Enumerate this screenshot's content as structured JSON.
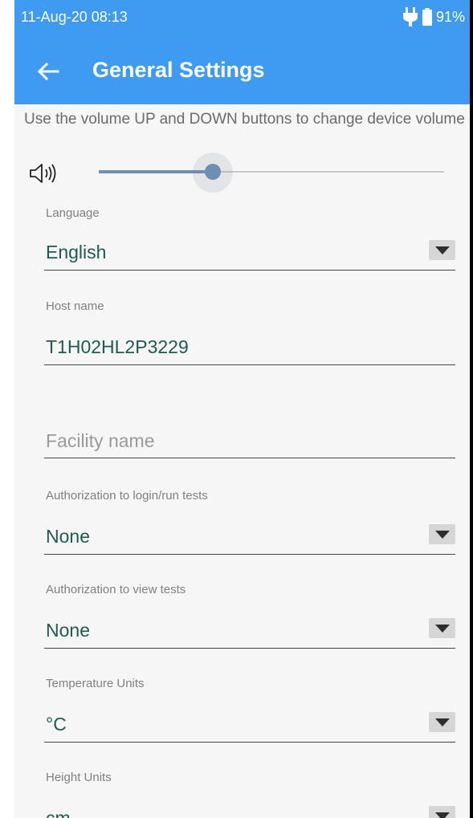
{
  "status_bar": {
    "datetime": "11-Aug-20 08:13",
    "battery": "91%",
    "icons": [
      "charging-plug-icon",
      "battery-icon"
    ]
  },
  "app_bar": {
    "title": "General Settings",
    "back_icon": "arrow-left-icon"
  },
  "volume": {
    "instruction": "Use the volume UP and DOWN buttons to change device volume",
    "icon": "speaker-icon",
    "level_fraction": 0.33
  },
  "fields": {
    "language": {
      "label": "Language",
      "value": "English"
    },
    "host_name": {
      "label": "Host name",
      "value": "T1H02HL2P3229"
    },
    "facility_name": {
      "placeholder": "Facility name",
      "value": ""
    },
    "auth_login": {
      "label": "Authorization to login/run tests",
      "value": "None"
    },
    "auth_view": {
      "label": "Authorization to view tests",
      "value": "None"
    },
    "temperature_units": {
      "label": "Temperature Units",
      "value": "°C"
    },
    "height_units": {
      "label": "Height Units",
      "value": "cm"
    }
  },
  "colors": {
    "app_bar": "#3f9bf2",
    "value_text": "#215b4f",
    "slider": "#6e8fb2"
  }
}
